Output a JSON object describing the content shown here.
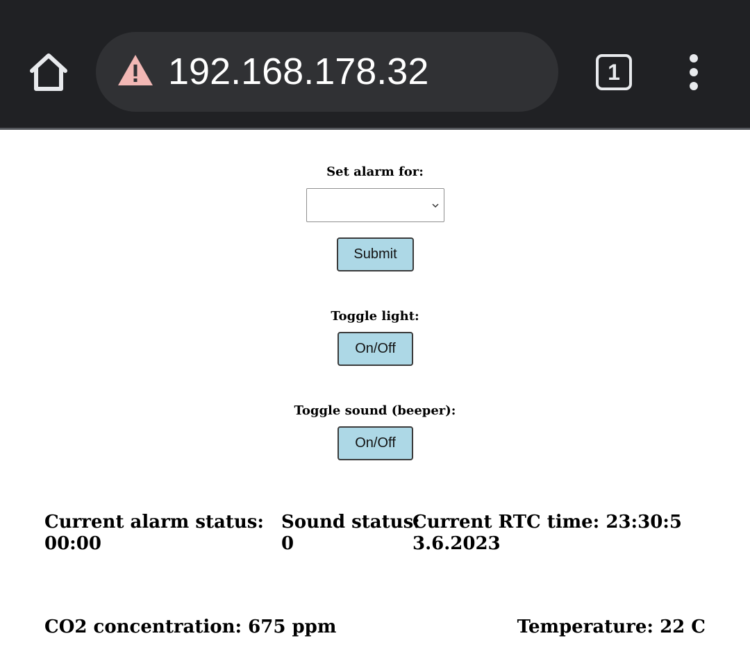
{
  "browser": {
    "url": "192.168.178.32",
    "tab_count": "1"
  },
  "form": {
    "alarm_label": "Set alarm for:",
    "alarm_select_value": "",
    "submit_label": "Submit",
    "light_label": "Toggle light:",
    "light_button": "On/Off",
    "sound_label": "Toggle sound (beeper):",
    "sound_button": "On/Off"
  },
  "status": {
    "alarm_title": "Current alarm status:",
    "alarm_value": "00:00",
    "sound_title": "Sound status:",
    "sound_value": "0",
    "rtc_title": "Current RTC time: 23:30:5",
    "rtc_date": "3.6.2023",
    "co2": "CO2 concentration: 675 ppm",
    "temperature": "Temperature: 22 C"
  },
  "colors": {
    "toolbar_bg": "#202124",
    "urlbar_bg": "#303134",
    "warning_icon": "#f2b8b5",
    "button_bg": "#add8e6"
  }
}
